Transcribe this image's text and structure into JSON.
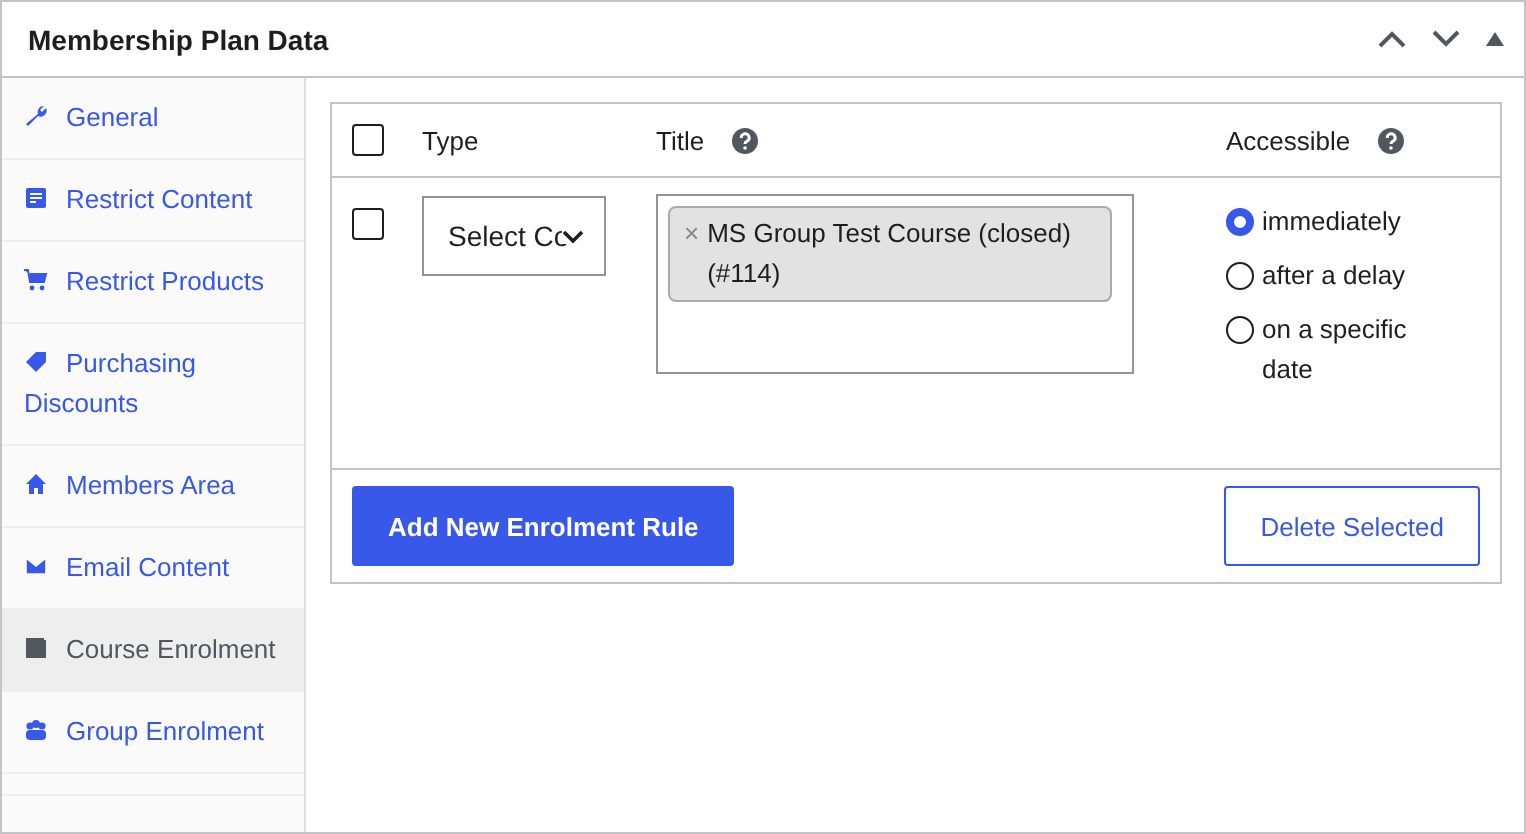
{
  "panel": {
    "title": "Membership Plan Data"
  },
  "sidebar": {
    "items": [
      {
        "label": "General",
        "selected": false
      },
      {
        "label": "Restrict Content",
        "selected": false
      },
      {
        "label": "Restrict Products",
        "selected": false
      },
      {
        "label": "Purchasing Discounts",
        "selected": false
      },
      {
        "label": "Members Area",
        "selected": false
      },
      {
        "label": "Email Content",
        "selected": false
      },
      {
        "label": "Course Enrolment",
        "selected": true
      },
      {
        "label": "Group Enrolment",
        "selected": false
      }
    ]
  },
  "table": {
    "select_all_checked": false,
    "columns": [
      {
        "label": "Type",
        "help": false
      },
      {
        "label": "Title",
        "help": true
      },
      {
        "label": "Accessible",
        "help": true
      }
    ],
    "rows": [
      {
        "checked": false,
        "type": "Select Co",
        "titles": [
          {
            "remove": "×",
            "label": "MS Group Test Course (closed) (#114)"
          }
        ],
        "accessible": [
          {
            "label": "immediately",
            "selected": true
          },
          {
            "label": "after a delay",
            "selected": false
          },
          {
            "label": "on a specific date",
            "selected": false
          }
        ]
      }
    ]
  },
  "buttons": [
    {
      "label": "Add New Enrolment Rule",
      "kind": "primary"
    },
    {
      "label": "Delete Selected",
      "kind": "secondary"
    }
  ]
}
